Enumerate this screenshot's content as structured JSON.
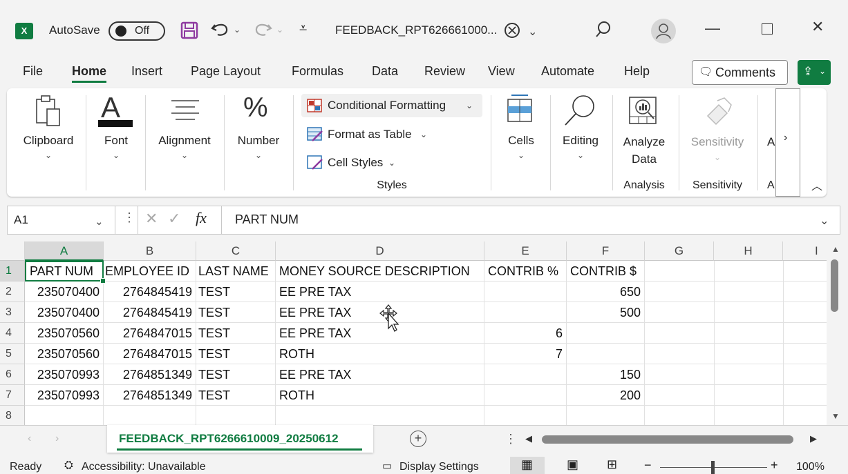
{
  "titlebar": {
    "app_icon": "X",
    "autosave_label": "AutoSave",
    "autosave_state": "Off",
    "filename": "FEEDBACK_RPT626661000...",
    "icons": [
      "save-icon",
      "undo-icon",
      "redo-icon",
      "customize-icon",
      "sync-icon",
      "search-icon",
      "avatar-icon"
    ]
  },
  "menu": {
    "items": [
      "File",
      "Home",
      "Insert",
      "Page Layout",
      "Formulas",
      "Data",
      "Review",
      "View",
      "Automate",
      "Help"
    ],
    "comments": "Comments"
  },
  "ribbon": {
    "clipboard": "Clipboard",
    "font": "Font",
    "alignment": "Alignment",
    "number": "Number",
    "conditional_formatting": "Conditional Formatting",
    "format_as_table": "Format as Table",
    "cell_styles": "Cell Styles",
    "styles_group": "Styles",
    "cells": "Cells",
    "editing": "Editing",
    "analyze_line1": "Analyze",
    "analyze_line2": "Data",
    "analysis_group": "Analysis",
    "sensitivity": "Sensitivity",
    "sensitivity_group": "Sensitivity",
    "more_label": "A",
    "more_group": "A"
  },
  "formula_bar": {
    "name_box": "A1",
    "content": "PART NUM",
    "fx": "fx"
  },
  "grid": {
    "columns": [
      "A",
      "B",
      "C",
      "D",
      "E",
      "F",
      "G",
      "H",
      "I"
    ],
    "rows": [
      "1",
      "2",
      "3",
      "4",
      "5",
      "6",
      "7",
      "8"
    ],
    "cells": [
      [
        "PART NUM",
        "EMPLOYEE ID",
        "LAST NAME",
        "MONEY SOURCE DESCRIPTION",
        "CONTRIB %",
        "CONTRIB $"
      ],
      [
        "235070400",
        "2764845419",
        "TEST",
        "EE PRE TAX",
        "",
        "650"
      ],
      [
        "235070400",
        "2764845419",
        "TEST",
        "EE PRE TAX",
        "",
        "500"
      ],
      [
        "235070560",
        "2764847015",
        "TEST",
        "EE PRE TAX",
        "6",
        ""
      ],
      [
        "235070560",
        "2764847015",
        "TEST",
        "ROTH",
        "7",
        ""
      ],
      [
        "235070993",
        "2764851349",
        "TEST",
        "EE PRE TAX",
        "",
        "150"
      ],
      [
        "235070993",
        "2764851349",
        "TEST",
        "ROTH",
        "",
        "200"
      ],
      [
        "",
        "",
        "",
        "",
        "",
        ""
      ]
    ]
  },
  "sheet_tabs": {
    "active": "FEEDBACK_RPT6266610009_20250612"
  },
  "status": {
    "ready": "Ready",
    "accessibility": "Accessibility: Unavailable",
    "display_settings": "Display Settings",
    "zoom": "100%"
  },
  "colors": {
    "accent": "#107c41",
    "conditional_icon": "#c0392b",
    "table_icon": "#2e75b6"
  }
}
